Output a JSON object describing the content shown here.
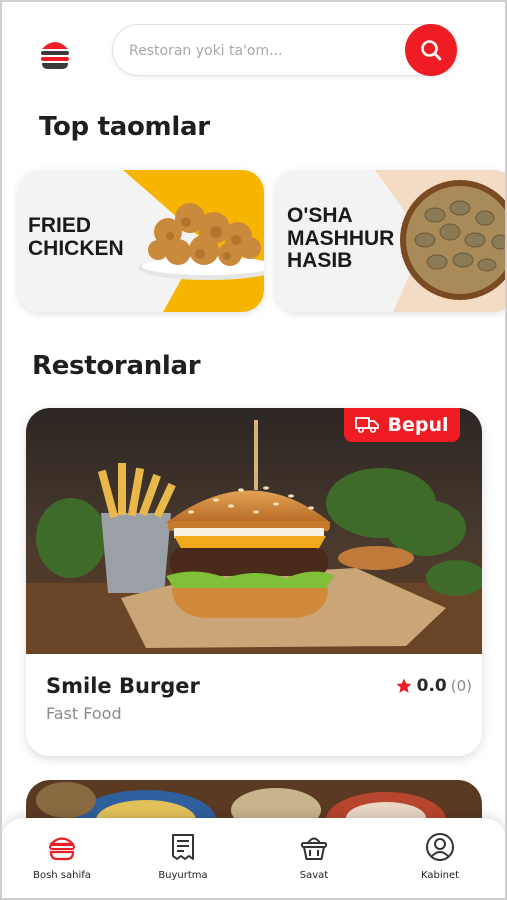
{
  "search": {
    "placeholder": "Restoran yoki ta'om..."
  },
  "sections": {
    "top_foods": "Top taomlar",
    "restaurants": "Restoranlar"
  },
  "top_foods": [
    {
      "label": "FRIED\nCHICKEN"
    },
    {
      "label": "O'SHA\nMASHHUR\nHASIB"
    }
  ],
  "restaurant": {
    "badge": "Bepul",
    "name": "Smile Burger",
    "category": "Fast Food",
    "rating": "0.0",
    "reviews": "(0)"
  },
  "nav": [
    {
      "label": "Bosh sahifa",
      "icon": "burger-icon",
      "active": true
    },
    {
      "label": "Buyurtma",
      "icon": "receipt-icon"
    },
    {
      "label": "Savat",
      "icon": "basket-icon"
    },
    {
      "label": "Kabinet",
      "icon": "user-icon"
    }
  ],
  "colors": {
    "accent": "#ef1c24",
    "yellow": "#f7b500",
    "beige": "#f3dcc3"
  }
}
